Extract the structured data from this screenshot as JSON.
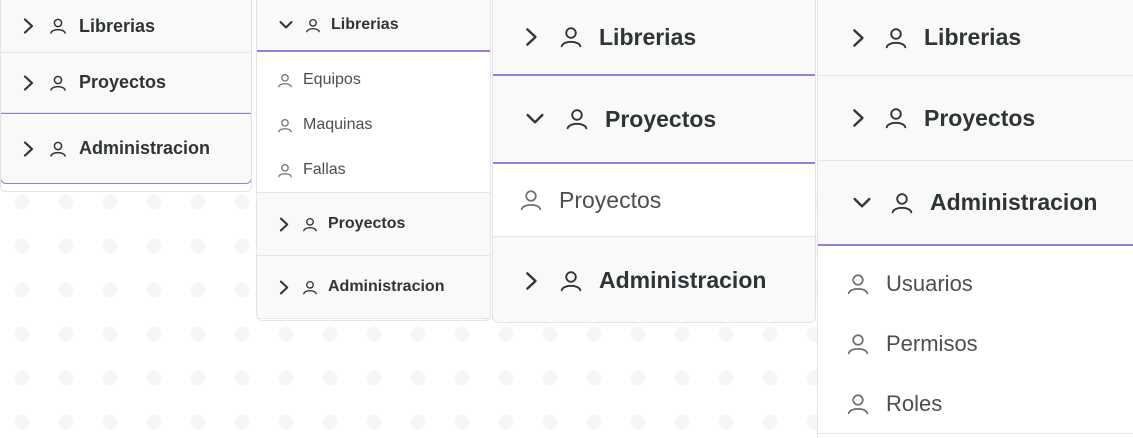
{
  "panel1": {
    "items": [
      {
        "label": "Librerias",
        "icon": "chevron-right-icon"
      },
      {
        "label": "Proyectos",
        "icon": "chevron-right-icon"
      },
      {
        "label": "Administracion",
        "icon": "chevron-right-icon"
      }
    ]
  },
  "panel2": {
    "header": {
      "label": "Librerias",
      "icon": "chevron-down-icon"
    },
    "subitems": [
      "Equipos",
      "Maquinas",
      "Fallas"
    ],
    "items": [
      {
        "label": "Proyectos",
        "icon": "chevron-right-icon"
      },
      {
        "label": "Administracion",
        "icon": "chevron-right-icon"
      }
    ]
  },
  "panel3": {
    "items": [
      {
        "label": "Librerias",
        "icon": "chevron-right-icon"
      },
      {
        "label": "Proyectos",
        "icon": "chevron-down-icon"
      }
    ],
    "subitems": [
      "Proyectos"
    ],
    "after": [
      {
        "label": "Administracion",
        "icon": "chevron-right-icon"
      }
    ]
  },
  "panel4": {
    "items": [
      {
        "label": "Librerias",
        "icon": "chevron-right-icon"
      },
      {
        "label": "Proyectos",
        "icon": "chevron-right-icon"
      },
      {
        "label": "Administracion",
        "icon": "chevron-down-icon"
      }
    ],
    "subitems": [
      "Usuarios",
      "Permisos",
      "Roles"
    ]
  },
  "colors": {
    "accent": "#8a84d8",
    "header_bg": "#f9f9fa",
    "text": "#2f3437",
    "border": "#e6e6e9"
  }
}
